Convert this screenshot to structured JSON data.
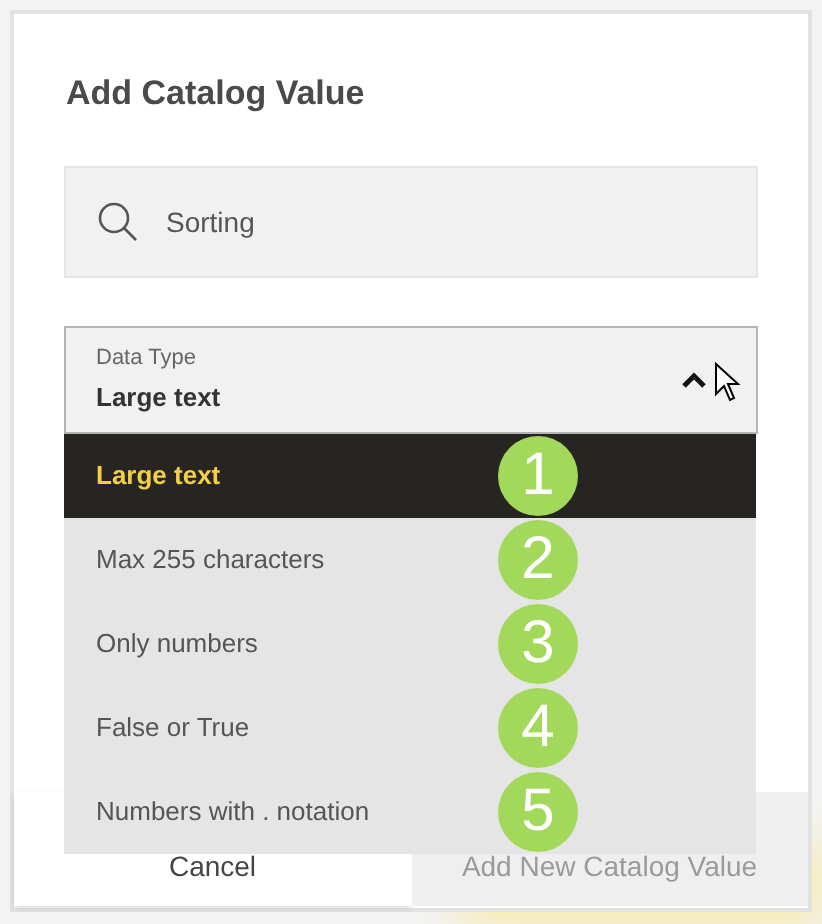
{
  "dialog": {
    "title": "Add Catalog Value"
  },
  "search": {
    "value": "Sorting"
  },
  "select": {
    "label": "Data Type",
    "value": "Large text",
    "expanded": true
  },
  "options": [
    {
      "label": "Large text",
      "selected": true,
      "badge": "1"
    },
    {
      "label": "Max 255 characters",
      "selected": false,
      "badge": "2"
    },
    {
      "label": "Only numbers",
      "selected": false,
      "badge": "3"
    },
    {
      "label": "False or True",
      "selected": false,
      "badge": "4"
    },
    {
      "label": "Numbers with . notation",
      "selected": false,
      "badge": "5"
    }
  ],
  "buttons": [
    {
      "label": "Cancel",
      "disabled": false
    },
    {
      "label": "Add New Catalog Value",
      "disabled": true
    }
  ]
}
